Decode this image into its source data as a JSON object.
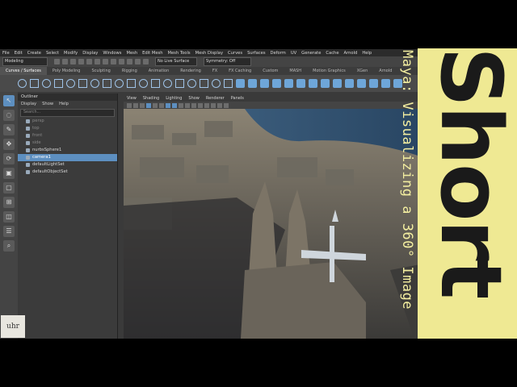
{
  "maya": {
    "menu": [
      "File",
      "Edit",
      "Create",
      "Select",
      "Modify",
      "Display",
      "Windows",
      "Mesh",
      "Edit Mesh",
      "Mesh Tools",
      "Mesh Display",
      "Curves",
      "Surfaces",
      "Deform",
      "UV",
      "Generate",
      "Cache",
      "Arnold",
      "Help"
    ],
    "mode": "Modeling",
    "live_surface": "No Live Surface",
    "symmetry": "Symmetry: Off",
    "shelf_tabs": [
      "Curves / Surfaces",
      "Poly Modeling",
      "Sculpting",
      "Rigging",
      "Animation",
      "Rendering",
      "FX",
      "FX Caching",
      "Custom",
      "MASH",
      "Motion Graphics",
      "XGen",
      "Arnold"
    ],
    "active_shelf_tab": "Curves / Surfaces"
  },
  "outliner": {
    "title": "Outliner",
    "menu": [
      "Display",
      "Show",
      "Help"
    ],
    "search_placeholder": "Search...",
    "items": [
      {
        "label": "persp",
        "state": "dim"
      },
      {
        "label": "top",
        "state": "dim"
      },
      {
        "label": "front",
        "state": "dim"
      },
      {
        "label": "side",
        "state": "dim"
      },
      {
        "label": "nurbsSphere1",
        "state": "normal"
      },
      {
        "label": "camera1",
        "state": "selected"
      },
      {
        "label": "defaultLightSet",
        "state": "normal"
      },
      {
        "label": "defaultObjectSet",
        "state": "normal"
      }
    ]
  },
  "viewport": {
    "menu": [
      "View",
      "Shading",
      "Lighting",
      "Show",
      "Renderer",
      "Panels"
    ],
    "readout": "sRGB gamma"
  },
  "overlay": {
    "side_title": "Maya: Visualizing a 360° Image",
    "badge": "Short",
    "logo": "uhr"
  },
  "colors": {
    "accent": "#5d8fc0",
    "badge_bg": "#efe993",
    "title_color": "#f3eea0"
  }
}
